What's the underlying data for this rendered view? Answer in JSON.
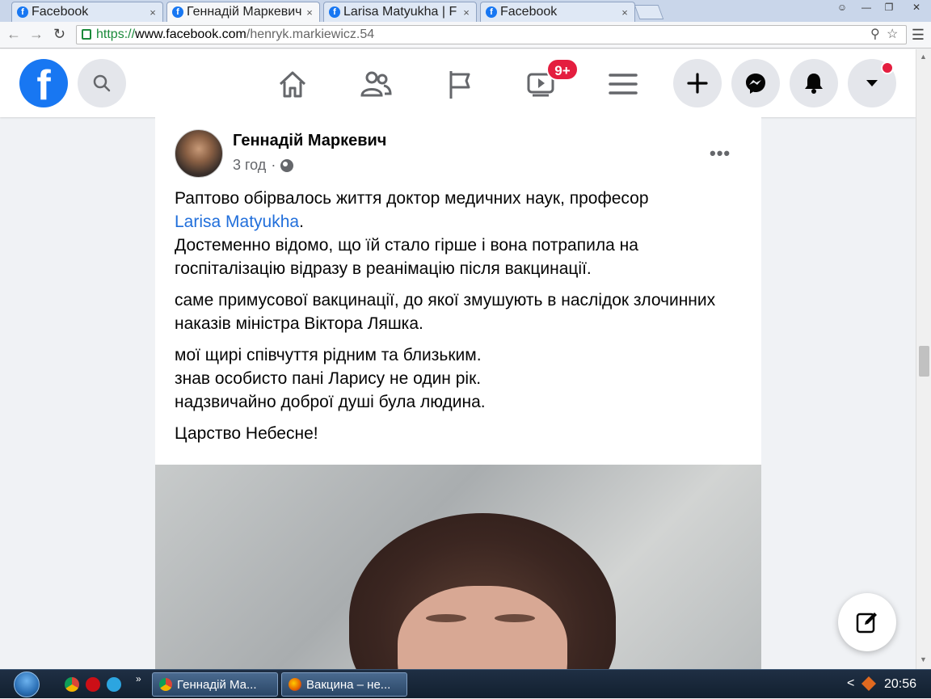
{
  "browser": {
    "tabs": [
      {
        "title": "Facebook",
        "active": false
      },
      {
        "title": "Геннадій Маркевич",
        "active": true
      },
      {
        "title": "Larisa Matyukha | F",
        "active": false
      },
      {
        "title": "Facebook",
        "active": false
      }
    ],
    "tab_close": "×",
    "url_scheme": "https://",
    "url_host": "www.facebook.com",
    "url_path": "/henryk.markiewicz.54"
  },
  "fb_header": {
    "logo_letter": "f",
    "watch_badge": "9+",
    "nav": [
      "home",
      "friends",
      "pages",
      "watch",
      "menu"
    ],
    "actions": [
      "create",
      "messenger",
      "notifications",
      "account"
    ]
  },
  "post": {
    "author": "Геннадій Маркевич",
    "time": "3 год",
    "time_separator": "·",
    "more": "•••",
    "paragraphs": [
      {
        "line1": "Раптово обірвалось життя доктор медичних наук, професор",
        "mention": "Larisa Matyukha",
        "after_mention": ".",
        "line3": "Достеменно відомо, що їй стало гірше і вона потрапила на госпіталізацію відразу в реанімацію після вакцинації."
      },
      {
        "text": "саме примусової вакцинації, до якої змушують в наслідок злочинних наказів міністра Віктора Ляшка."
      },
      {
        "line1": "мої щирі співчуття рідним та близьким.",
        "line2": "знав особисто пані Ларису не один рік.",
        "line3": "надзвичайно доброї душі була людина."
      },
      {
        "text": "Царство Небесне!"
      }
    ]
  },
  "taskbar": {
    "items": [
      {
        "label": "Геннадій Ма..."
      },
      {
        "label": "Вакцина – не..."
      }
    ],
    "clock": "20:56",
    "tray_chevron": "<"
  },
  "colors": {
    "fb_blue": "#1877f2",
    "mention": "#216fdb",
    "badge_red": "#e41e3f",
    "page_bg": "#f0f2f5"
  }
}
